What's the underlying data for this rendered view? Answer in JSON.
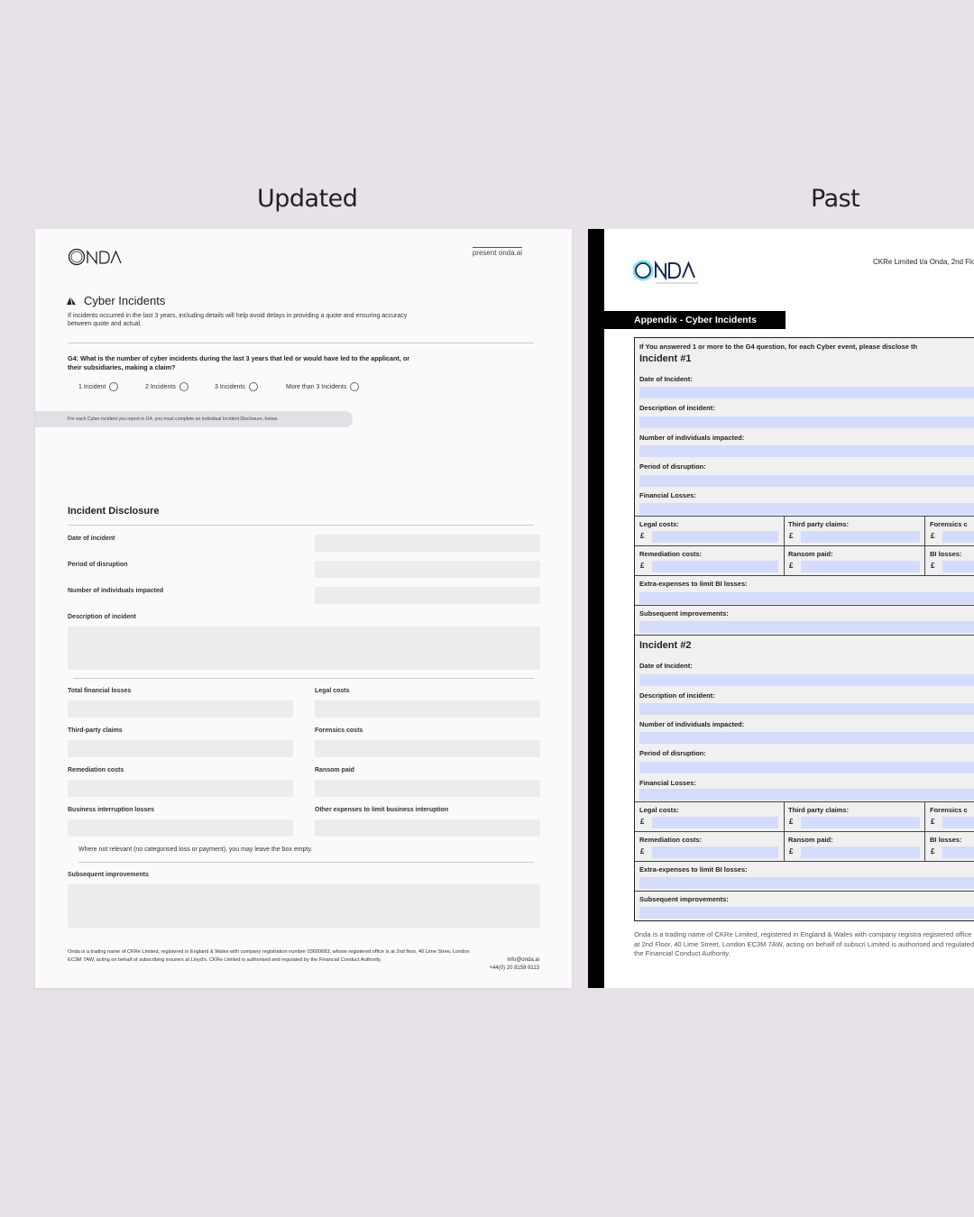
{
  "labels": {
    "updated": "Updated",
    "past": "Past"
  },
  "updated": {
    "present": "present onda.ai",
    "section_title": "Cyber Incidents",
    "intro": "If incidents occurred in the last 3 years, including details will help avoid delays in providing a quote and ensuring accuracy between quote and actual.",
    "question": "G4: What is the number of cyber incidents during the last 3 years that led or would have led to the applicant, or their subsidiaries, making a claim?",
    "options": [
      "1 Incident",
      "2 Incidents",
      "3 Incidents",
      "More than 3 Incidents"
    ],
    "note": "For each Cyber incident you report in G4, you must complete an individual Incident Disclosure, below.",
    "disclosure_title": "Incident Disclosure",
    "fields": {
      "date": "Date of incident",
      "period": "Period of disruption",
      "individuals": "Number of individuals impacted",
      "description": "Description of incident",
      "total": "Total financial losses",
      "legal": "Legal costs",
      "third": "Third-party claims",
      "forensics": "Forensics costs",
      "remediation": "Remediation costs",
      "ransom": "Ransom paid",
      "bi": "Business interruption losses",
      "other": "Other expenses to limit business interuption",
      "improvements": "Subsequent improvements"
    },
    "hint": "Where not relevant (no categorised loss or payment), you may leave the box empty.",
    "footer": "Onda is a trading name of CKRe Limited, registered in England & Wales with company registration number 03600683, whose registered office is at 2nd floor, 40 Lime Stree, London EC3M 7AW, acting on behalf of subscribing insurers at Lloyd's. CKRe Limited is authorised and regulated by the Financial Conduct Authority.",
    "email": "info@onda.ai",
    "phone": "+44(0) 20 8158 9113"
  },
  "past": {
    "address": "CKRe Limited t/a Onda, 2nd Floo",
    "title": "Appendix - Cyber Incidents",
    "instruction": "If You answered 1 or more to the G4 question, for each Cyber event, please disclose th",
    "incident1": "Incident #1",
    "incident2": "Incident #2",
    "date": "Date of Incident:",
    "description": "Description of incident:",
    "individuals": "Number of individuals impacted:",
    "period": "Period of disruption:",
    "financial": "Financial Losses:",
    "legal": "Legal costs:",
    "third": "Third party claims:",
    "forensics": "Forensics c",
    "remediation": "Remediation costs:",
    "ransom": "Ransom paid:",
    "bi": "BI losses:",
    "extra": "Extra-expenses to limit BI losses:",
    "improvements": "Subsequent improvements:",
    "pound": "£",
    "footer": "Onda is a trading name of CKRe Limited, registered in England & Wales with company registra registered office is at 2nd Floor, 40 Lime Street, London EC3M 7AW, acting on behalf of subscri Limited is authorised and regulated by the Financial Conduct Authority."
  }
}
